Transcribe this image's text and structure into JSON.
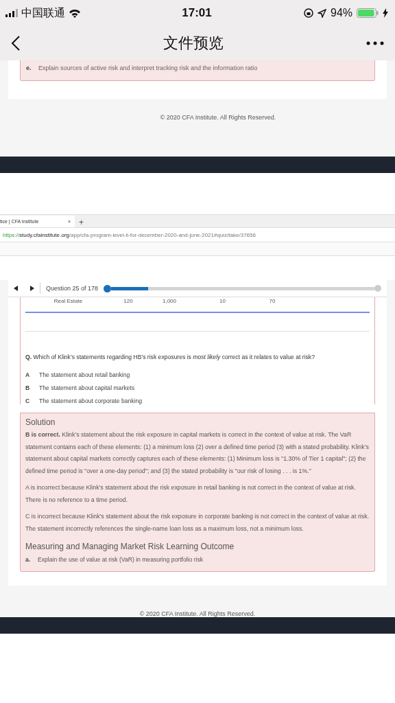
{
  "status_bar": {
    "carrier": "中国联通",
    "time": "17:01",
    "battery": "94%"
  },
  "nav_bar": {
    "title": "文件预览"
  },
  "upper_page": {
    "outcome": {
      "letter": "e.",
      "text": "Explain sources of active risk and interpret tracking risk and the information ratio"
    },
    "footer": "© 2020 CFA Institute. All Rights Reserved."
  },
  "browser": {
    "tab": {
      "title": "tice | CFA Institute",
      "close": "×"
    },
    "new_tab": "+",
    "url": {
      "scheme": "https://",
      "host": "study.cfainstitute.org",
      "path": "/app/cfa-program-level-ii-for-december-2020-and-june-2021#quiz/take/37656"
    }
  },
  "quiz": {
    "question_counter": "Question 25 of 178",
    "progress": {
      "level": 0.14
    },
    "table_row": [
      "Real Estate",
      "120",
      "1,000",
      "10",
      "70"
    ],
    "question": "**Q.** Which of Klink’s statements regarding HB’s risk exposures is *most likely* correct as it relates to value at risk?",
    "options": [
      {
        "letter": "A",
        "text": "The statement about retail banking"
      },
      {
        "letter": "B",
        "text": "The statement about capital markets"
      },
      {
        "letter": "C",
        "text": "The statement about corporate banking"
      }
    ],
    "solution": {
      "title": "Solution",
      "paragraphs": [
        "**B is correct.** Klink’s statement about the risk exposure in capital markets is correct in the context of value at risk. The VaR statement contains each of these elements: (1) a minimum loss (2) over a defined time period (3) with a stated probability. Klink’s statement about capital markets correctly captures each of these elements: (1) Minimum loss is \"1.30% of Tier 1 capital\"; (2) the defined time period is \"over a one-day period\"; and (3) the stated probability is \"our risk of losing . . . is 1%.\"",
        "A is incorrect because Klink’s statement about the risk exposure in retail banking is not correct in the context of value at risk. There is no reference to a time period.",
        "C is incorrect because Klink’s statement about the risk exposure in corporate banking is not correct in the context of value at risk. The statement incorrectly references the single-name loan loss as a maximum loss, not a minimum loss."
      ],
      "outcome_title": "Measuring and Managing Market Risk Learning Outcome",
      "outcome": {
        "letter": "a.",
        "text": "Explain the use of value at risk (VaR) in measuring portfolio risk"
      }
    },
    "footer": "© 2020 CFA Institute. All Rights Reserved."
  }
}
